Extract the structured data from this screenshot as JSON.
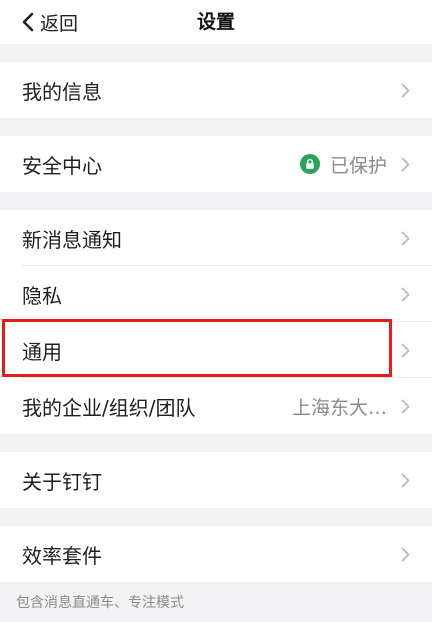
{
  "header": {
    "back_label": "返回",
    "title": "设置"
  },
  "groups": [
    {
      "items": [
        {
          "label": "我的信息"
        }
      ]
    },
    {
      "items": [
        {
          "label": "安全中心",
          "value": "已保护",
          "value_icon": "lock-icon"
        }
      ]
    },
    {
      "items": [
        {
          "label": "新消息通知"
        },
        {
          "label": "隐私"
        },
        {
          "label": "通用"
        },
        {
          "label": "我的企业/组织/团队",
          "value": "上海东大…"
        }
      ]
    },
    {
      "items": [
        {
          "label": "关于钉钉"
        }
      ]
    },
    {
      "items": [
        {
          "label": "效率套件"
        }
      ]
    }
  ],
  "footer": {
    "hint": "包含消息直通车、专注模式"
  },
  "colors": {
    "highlight_border": "#e41b1b",
    "protected_green": "#2aa35a",
    "background": "#f2f2f4"
  }
}
